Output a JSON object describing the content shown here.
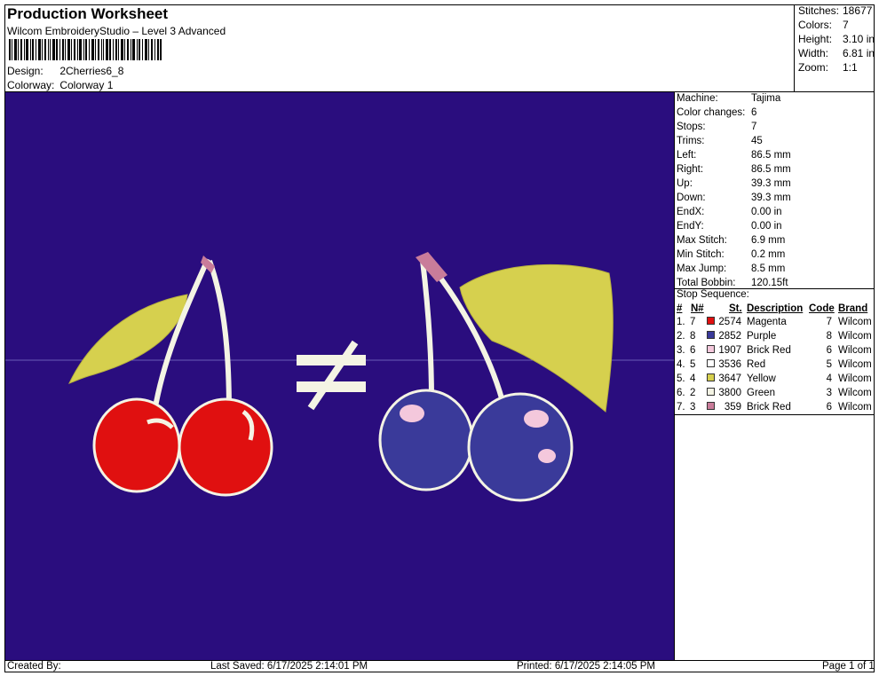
{
  "header": {
    "title": "Production Worksheet",
    "subtitle": "Wilcom EmbroideryStudio – Level 3 Advanced",
    "design_label": "Design:",
    "design_value": "2Cherries6_8",
    "colorway_label": "Colorway:",
    "colorway_value": "Colorway 1"
  },
  "stats": {
    "stitches_label": "Stitches:",
    "stitches_value": "18677",
    "colors_label": "Colors:",
    "colors_value": "7",
    "height_label": "Height:",
    "height_value": "3.10 in",
    "width_label": "Width:",
    "width_value": "6.81 in",
    "zoom_label": "Zoom:",
    "zoom_value": "1:1"
  },
  "info": [
    {
      "k": "Machine:",
      "v": "Tajima"
    },
    {
      "k": "Color changes:",
      "v": "6"
    },
    {
      "k": "Stops:",
      "v": "7"
    },
    {
      "k": "Trims:",
      "v": "45"
    },
    {
      "k": "Left:",
      "v": "86.5 mm"
    },
    {
      "k": "Right:",
      "v": "86.5 mm"
    },
    {
      "k": "Up:",
      "v": "39.3 mm"
    },
    {
      "k": "Down:",
      "v": "39.3 mm"
    },
    {
      "k": "EndX:",
      "v": "0.00 in"
    },
    {
      "k": "EndY:",
      "v": "0.00 in"
    },
    {
      "k": "Max Stitch:",
      "v": "6.9 mm"
    },
    {
      "k": "Min Stitch:",
      "v": "0.2 mm"
    },
    {
      "k": "Max Jump:",
      "v": "8.5 mm"
    },
    {
      "k": "Total Bobbin:",
      "v": "120.15ft"
    }
  ],
  "sequence": {
    "title": "Stop Sequence:",
    "headers": {
      "num": "#",
      "n": "N#",
      "st": "St.",
      "desc": "Description",
      "code": "Code",
      "brand": "Brand"
    },
    "rows": [
      {
        "num": "1.",
        "n": "7",
        "color": "#e01010",
        "st": "2574",
        "desc": "Magenta",
        "code": "7",
        "brand": "Wilcom"
      },
      {
        "num": "2.",
        "n": "8",
        "color": "#3a3a9a",
        "st": "2852",
        "desc": "Purple",
        "code": "8",
        "brand": "Wilcom"
      },
      {
        "num": "3.",
        "n": "6",
        "color": "#f4c8dc",
        "st": "1907",
        "desc": "Brick Red",
        "code": "6",
        "brand": "Wilcom"
      },
      {
        "num": "4.",
        "n": "5",
        "color": "#ffffff",
        "st": "3536",
        "desc": "Red",
        "code": "5",
        "brand": "Wilcom"
      },
      {
        "num": "5.",
        "n": "4",
        "color": "#d6d04e",
        "st": "3647",
        "desc": "Yellow",
        "code": "4",
        "brand": "Wilcom"
      },
      {
        "num": "6.",
        "n": "2",
        "color": "#f4f4e4",
        "st": "3800",
        "desc": "Green",
        "code": "3",
        "brand": "Wilcom"
      },
      {
        "num": "7.",
        "n": "3",
        "color": "#c97c9a",
        "st": "359",
        "desc": "Brick Red",
        "code": "6",
        "brand": "Wilcom"
      }
    ]
  },
  "footer": {
    "created": "Created By:",
    "saved": "Last Saved: 6/17/2025 2:14:01 PM",
    "printed": "Printed: 6/17/2025 2:14:05 PM",
    "page": "Page 1 of 1"
  },
  "colors": {
    "background": "#2a0d7e",
    "red_cherry": "#e01010",
    "purple_cherry": "#3a3a9a",
    "leaf": "#d6d04e",
    "stem": "#f4f4e4",
    "tip": "#c97c9a"
  }
}
